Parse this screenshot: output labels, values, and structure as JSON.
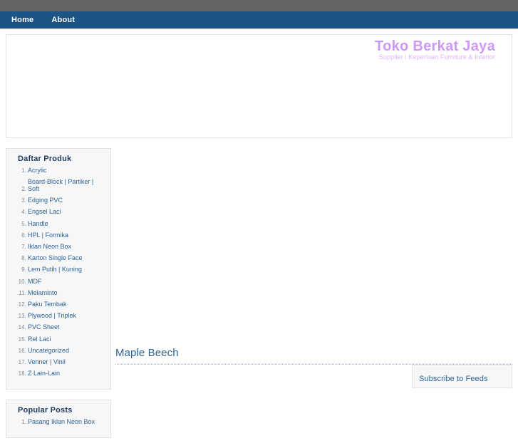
{
  "nav": {
    "items": [
      {
        "label": "Home",
        "name": "nav-item-home"
      },
      {
        "label": "About",
        "name": "nav-item-about"
      }
    ]
  },
  "header": {
    "site_title": "Toko Berkat Jaya",
    "tagline": "Supplier : Keperluan Furniture & Interior",
    "title_color": "#cc99f7",
    "tagline_color": "#dcb6f7"
  },
  "sidebar": {
    "widgets": [
      {
        "title": "Daftar Produk",
        "items": [
          "Acrylic",
          "Board-Block | Partiker | Soft",
          "Edging PVC",
          "Engsel Laci",
          "Handle",
          "HPL | Formika",
          "Iklan Neon Box",
          "Karton Single Face",
          "Lem Putih | Kuning",
          "MDF",
          "Melaminto",
          "Paku Tembak",
          "Plywood | Triplek",
          "PVC Sheet",
          "Rel Laci",
          "Uncategorized",
          "Venner | Vinil",
          "Z Lain-Lain"
        ]
      },
      {
        "title": "Popular Posts",
        "items": [
          "Pasang Iklan Neon Box"
        ]
      }
    ]
  },
  "main": {
    "post_title": "Maple Beech"
  },
  "subscribe": {
    "title": "Subscribe to Feeds"
  },
  "theme": {
    "top_strip": "#666564",
    "navbar": "#1c5485",
    "link": "#2c6398",
    "widget_bg": "#f7f7f7",
    "widget_border": "#e4e4e4"
  }
}
